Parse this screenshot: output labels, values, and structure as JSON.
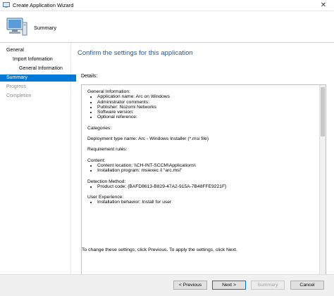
{
  "window": {
    "title": "Create Application Wizard",
    "close_glyph": "✕"
  },
  "header": {
    "title": "Summary"
  },
  "sidebar": {
    "items": [
      {
        "label": "General"
      },
      {
        "label": "Import Information"
      },
      {
        "label": "General Information"
      },
      {
        "label": "Summary"
      },
      {
        "label": "Progress"
      },
      {
        "label": "Completion"
      }
    ]
  },
  "main": {
    "heading": "Confirm the settings for this application",
    "details_label": "Details:",
    "details": {
      "general_heading": "General Information:",
      "general_items": [
        "Application name: Arc on Windows",
        "Administrator comments:",
        "Publisher: Nozomi Networks",
        "Software version:",
        "Optional reference:"
      ],
      "categories": "Categories:",
      "deployment_type": "Deployment type name: Arc - Windows Installer (*.msi file)",
      "requirement_rules": "Requirement rules:",
      "content_heading": "Content:",
      "content_items": [
        "Content location: \\\\CH-INT-SCCM\\Applications\\",
        "Installation program: msiexec /i \"arc.msi\""
      ],
      "detection_heading": "Detection Method:",
      "detection_items": [
        "Product code: {BAFD8613-B829-47A2-915A-7B48FFE9221F}"
      ],
      "ux_heading": "User Experience:",
      "ux_items": [
        "Installation behavior: Install for user"
      ]
    },
    "footer_note": "To change these settings, click Previous. To apply the settings, click Next."
  },
  "buttons": {
    "previous": "< Previous",
    "next": "Next >",
    "summary": "Summary",
    "cancel": "Cancel"
  },
  "colors": {
    "accent": "#0078d7",
    "heading": "#1a5ca8"
  }
}
